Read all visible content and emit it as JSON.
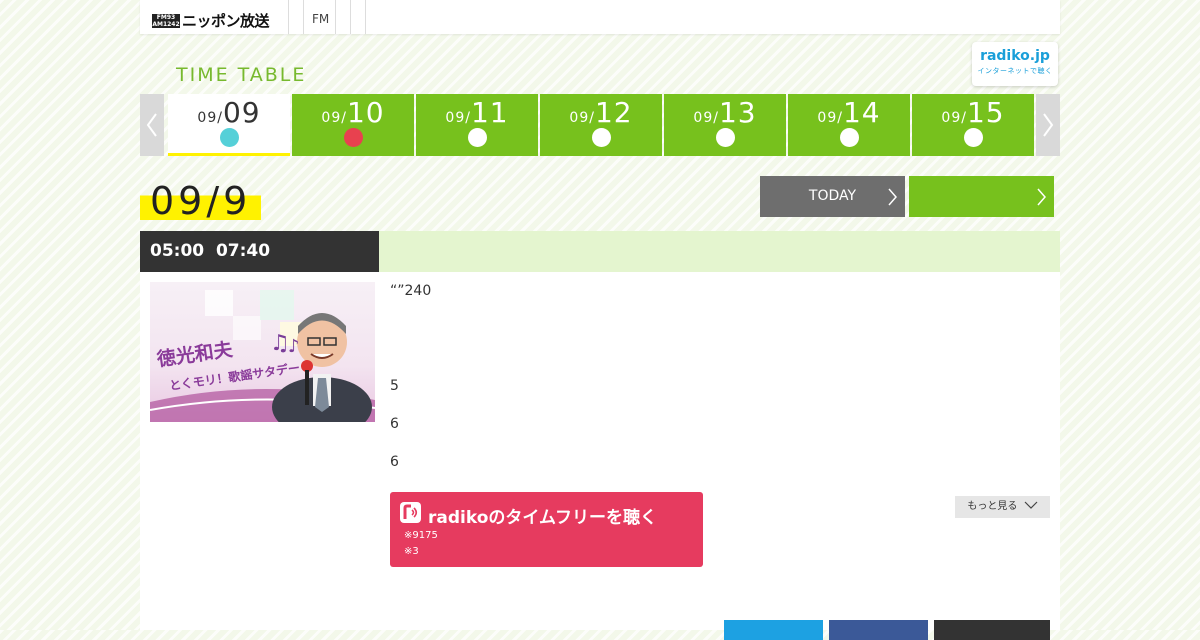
{
  "header": {
    "logo_mark_top": "FM93",
    "logo_mark_bottom": "AM1242",
    "logo_text": "ニッポン放送",
    "nav_fm": "FM"
  },
  "timetable": {
    "title": "TIME TABLE",
    "radiko_badge": {
      "name": "radiko.jp",
      "tagline": "インターネットで聴く"
    }
  },
  "dates": [
    {
      "month": "09/",
      "day": "09",
      "active": true,
      "dot_color": "#55d0d8"
    },
    {
      "month": "09/",
      "day": "10",
      "active": false,
      "dot_color": "#e8414f"
    },
    {
      "month": "09/",
      "day": "11",
      "active": false,
      "dot_color": "#ffffff"
    },
    {
      "month": "09/",
      "day": "12",
      "active": false,
      "dot_color": "#ffffff"
    },
    {
      "month": "09/",
      "day": "13",
      "active": false,
      "dot_color": "#ffffff"
    },
    {
      "month": "09/",
      "day": "14",
      "active": false,
      "dot_color": "#ffffff"
    },
    {
      "month": "09/",
      "day": "15",
      "active": false,
      "dot_color": "#ffffff"
    }
  ],
  "day_heading": "09/9",
  "buttons": {
    "today": "TODAY",
    "next": ""
  },
  "program": {
    "start": "05:00",
    "end": "07:40",
    "thumbnail": {
      "name": "徳光和夫",
      "subtitle": "とくモリ！歌謡サタデー"
    },
    "desc_line1": "“”240",
    "desc_line2": "5",
    "desc_line3": "6",
    "desc_line4": "6",
    "timefree": {
      "label": "radikoのタイムフリーを聴く",
      "note1": "※9175",
      "note2": "※3"
    },
    "more": "もっと見る"
  },
  "colors": {
    "accent_green": "#77c11d",
    "title_green": "#77b92e",
    "radiko_red": "#e63b5f",
    "highlight_yellow": "#fff200",
    "time_bg": "#333333"
  }
}
